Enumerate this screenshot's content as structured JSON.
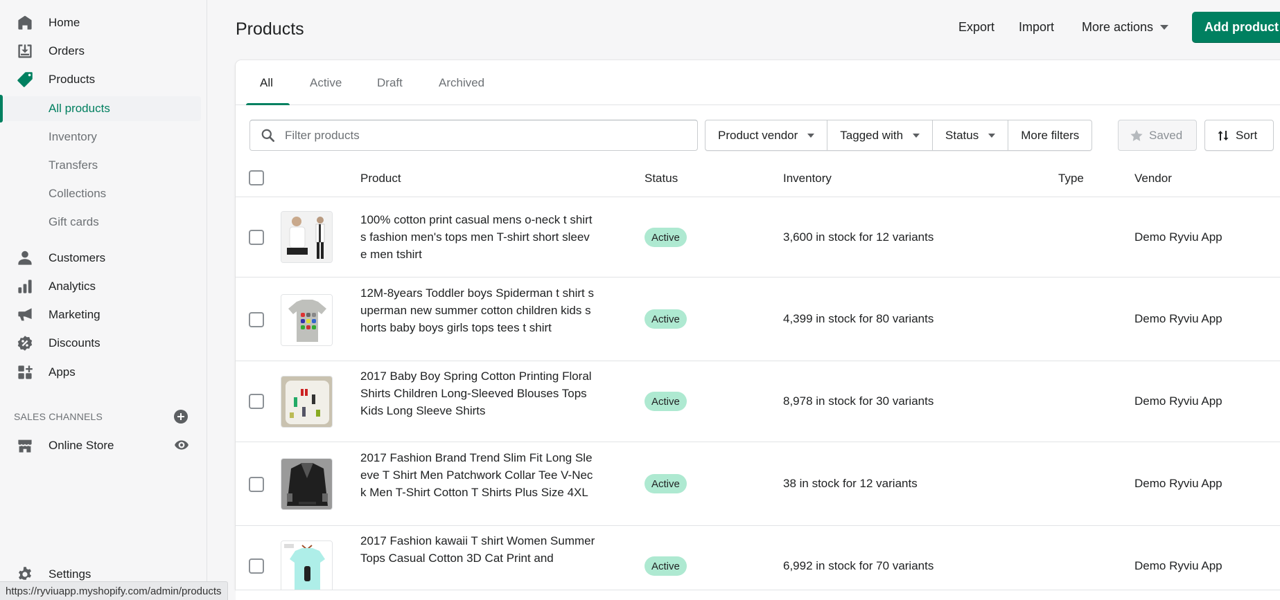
{
  "sidebar": {
    "nav": [
      {
        "label": "Home",
        "icon": "home-icon"
      },
      {
        "label": "Orders",
        "icon": "orders-icon"
      },
      {
        "label": "Products",
        "icon": "tag-icon"
      }
    ],
    "products_sub": [
      {
        "label": "All products",
        "selected": true
      },
      {
        "label": "Inventory"
      },
      {
        "label": "Transfers"
      },
      {
        "label": "Collections"
      },
      {
        "label": "Gift cards"
      }
    ],
    "nav2": [
      {
        "label": "Customers",
        "icon": "customer-icon"
      },
      {
        "label": "Analytics",
        "icon": "analytics-icon"
      },
      {
        "label": "Marketing",
        "icon": "megaphone-icon"
      },
      {
        "label": "Discounts",
        "icon": "discount-icon"
      },
      {
        "label": "Apps",
        "icon": "apps-icon"
      }
    ],
    "sales_channels_label": "SALES CHANNELS",
    "online_store": {
      "label": "Online Store",
      "icon": "store-icon"
    },
    "settings": {
      "label": "Settings",
      "icon": "gear-icon"
    }
  },
  "status_bar": {
    "url": "https://ryviuapp.myshopify.com/admin/products"
  },
  "header": {
    "title": "Products",
    "export_label": "Export",
    "import_label": "Import",
    "more_actions_label": "More actions",
    "add_product_label": "Add product"
  },
  "tabs": [
    {
      "label": "All",
      "active": true
    },
    {
      "label": "Active"
    },
    {
      "label": "Draft"
    },
    {
      "label": "Archived"
    }
  ],
  "filters": {
    "search_placeholder": "Filter products",
    "search_value": "",
    "product_vendor": "Product vendor",
    "tagged_with": "Tagged with",
    "status": "Status",
    "more_filters": "More filters",
    "saved": "Saved",
    "sort": "Sort"
  },
  "table": {
    "columns": {
      "product": "Product",
      "status": "Status",
      "inventory": "Inventory",
      "type": "Type",
      "vendor": "Vendor"
    },
    "rows": [
      {
        "name": "100% cotton print casual mens o-neck t shirts fashion men's tops men T-shirt short sleeve men tshirt",
        "status": "Active",
        "inventory": "3,600 in stock for 12 variants",
        "type": "",
        "vendor": "Demo Ryviu App"
      },
      {
        "name": "12M-8years Toddler boys Spiderman t shirt superman new summer cotton children kids shorts baby boys girls tops tees t shirt",
        "status": "Active",
        "inventory": "4,399 in stock for 80 variants",
        "type": "",
        "vendor": "Demo Ryviu App"
      },
      {
        "name": "2017 Baby Boy Spring Cotton Printing Floral Shirts Children Long-Sleeved Blouses Tops Kids Long Sleeve Shirts",
        "status": "Active",
        "inventory": "8,978 in stock for 30 variants",
        "type": "",
        "vendor": "Demo Ryviu App"
      },
      {
        "name": "2017 Fashion Brand Trend Slim Fit Long Sleeve T Shirt Men Patchwork Collar Tee V-Neck Men T-Shirt Cotton T Shirts Plus Size 4XL",
        "status": "Active",
        "inventory": "38 in stock for 12 variants",
        "type": "",
        "vendor": "Demo Ryviu App"
      },
      {
        "name": "2017 Fashion kawaii T shirt Women Summer Tops Casual Cotton 3D Cat Print and",
        "status": "Active",
        "inventory": "6,992 in stock for 70 variants",
        "type": "",
        "vendor": "Demo Ryviu App"
      }
    ]
  },
  "colors": {
    "accent": "#008060",
    "badge_active": "#aee9d1",
    "sidebar_bg": "#f6f6f7"
  }
}
